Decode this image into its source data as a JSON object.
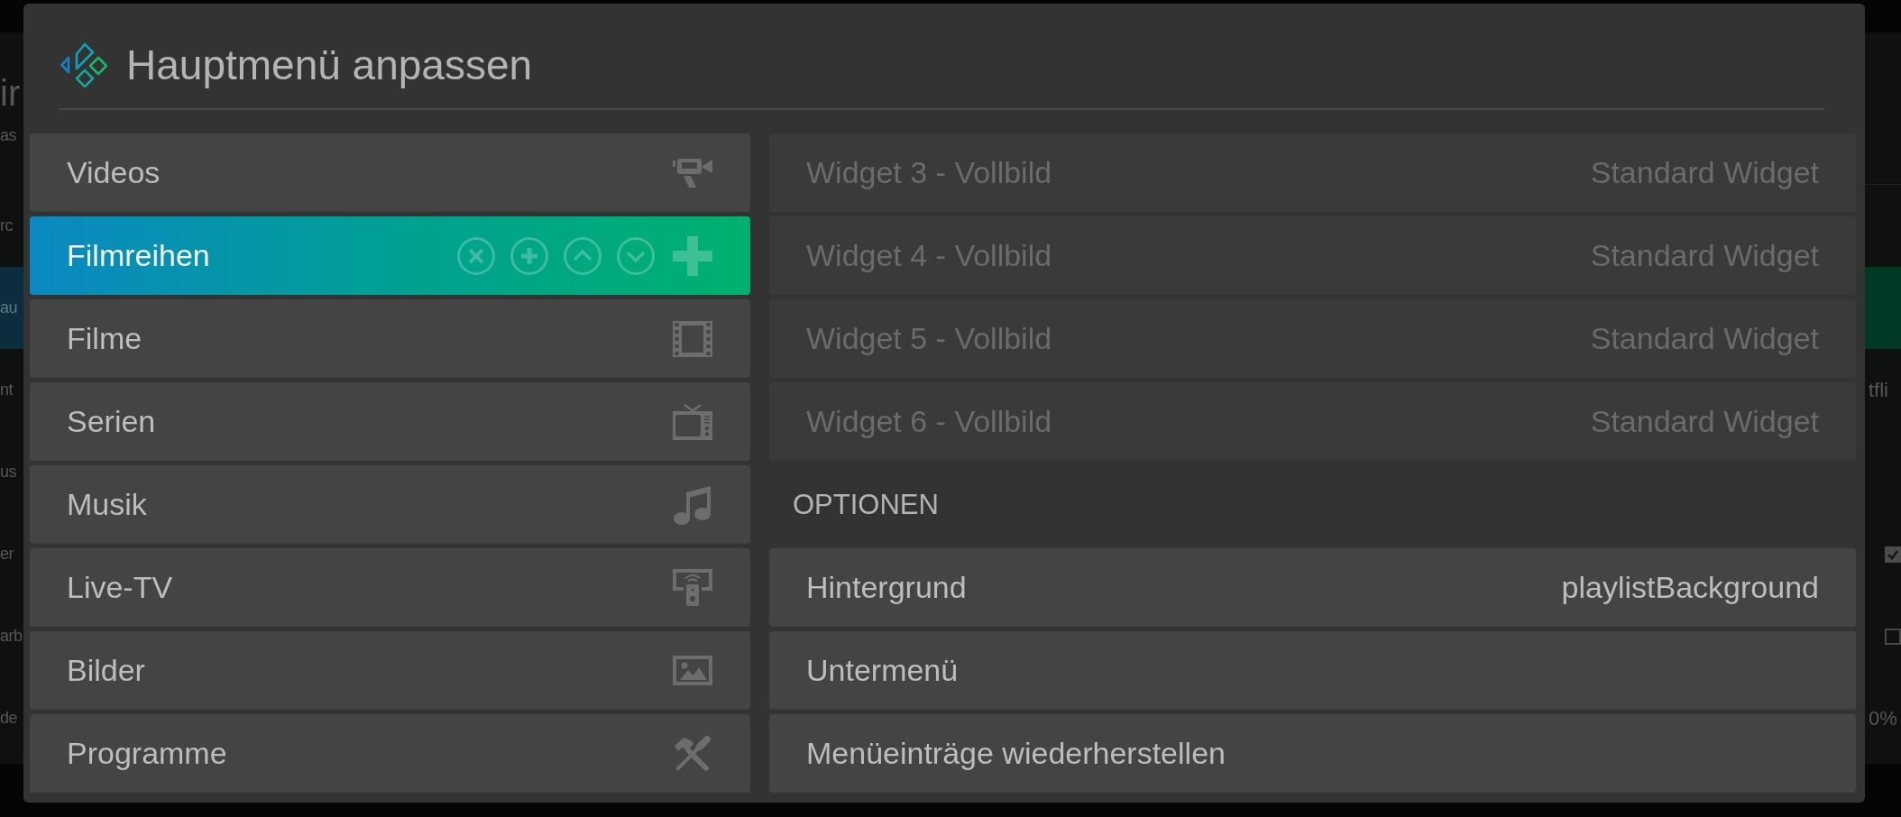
{
  "background": {
    "title": "ir",
    "subtitle": "as",
    "rows": [
      {
        "kind": "plain",
        "label": "rc",
        "selected": false
      },
      {
        "kind": "plain",
        "label": "au",
        "selected": true
      },
      {
        "kind": "value",
        "label": "nt",
        "value": "tfli",
        "selected": false
      },
      {
        "kind": "plain",
        "label": "us",
        "selected": false
      },
      {
        "kind": "checkbox",
        "label": "er",
        "checked": true,
        "selected": false
      },
      {
        "kind": "checkbox",
        "label": "arb",
        "checked": false,
        "selected": false
      },
      {
        "kind": "value",
        "label": "de",
        "value": "0%",
        "selected": false
      }
    ]
  },
  "dialog": {
    "title": "Hauptmenü anpassen",
    "menu_items": [
      {
        "label": "Videos",
        "selected": false
      },
      {
        "label": "Filmreihen",
        "selected": true
      },
      {
        "label": "Filme",
        "selected": false
      },
      {
        "label": "Serien",
        "selected": false
      },
      {
        "label": "Musik",
        "selected": false
      },
      {
        "label": "Live-TV",
        "selected": false
      },
      {
        "label": "Bilder",
        "selected": false
      },
      {
        "label": "Programme",
        "selected": false
      }
    ],
    "widgets": [
      {
        "label": "Widget 3 - Vollbild",
        "value": "Standard Widget",
        "disabled": true
      },
      {
        "label": "Widget 4 - Vollbild",
        "value": "Standard Widget",
        "disabled": true
      },
      {
        "label": "Widget 5 - Vollbild",
        "value": "Standard Widget",
        "disabled": true
      },
      {
        "label": "Widget 6 - Vollbild",
        "value": "Standard Widget",
        "disabled": true
      }
    ],
    "options": {
      "heading": "OPTIONEN",
      "items": [
        {
          "label": "Hintergrund",
          "value": "playlistBackground",
          "disabled": false
        },
        {
          "label": "Untermenü",
          "disabled": false
        },
        {
          "label": "Menüeinträge wiederherstellen",
          "disabled": false
        }
      ]
    }
  }
}
